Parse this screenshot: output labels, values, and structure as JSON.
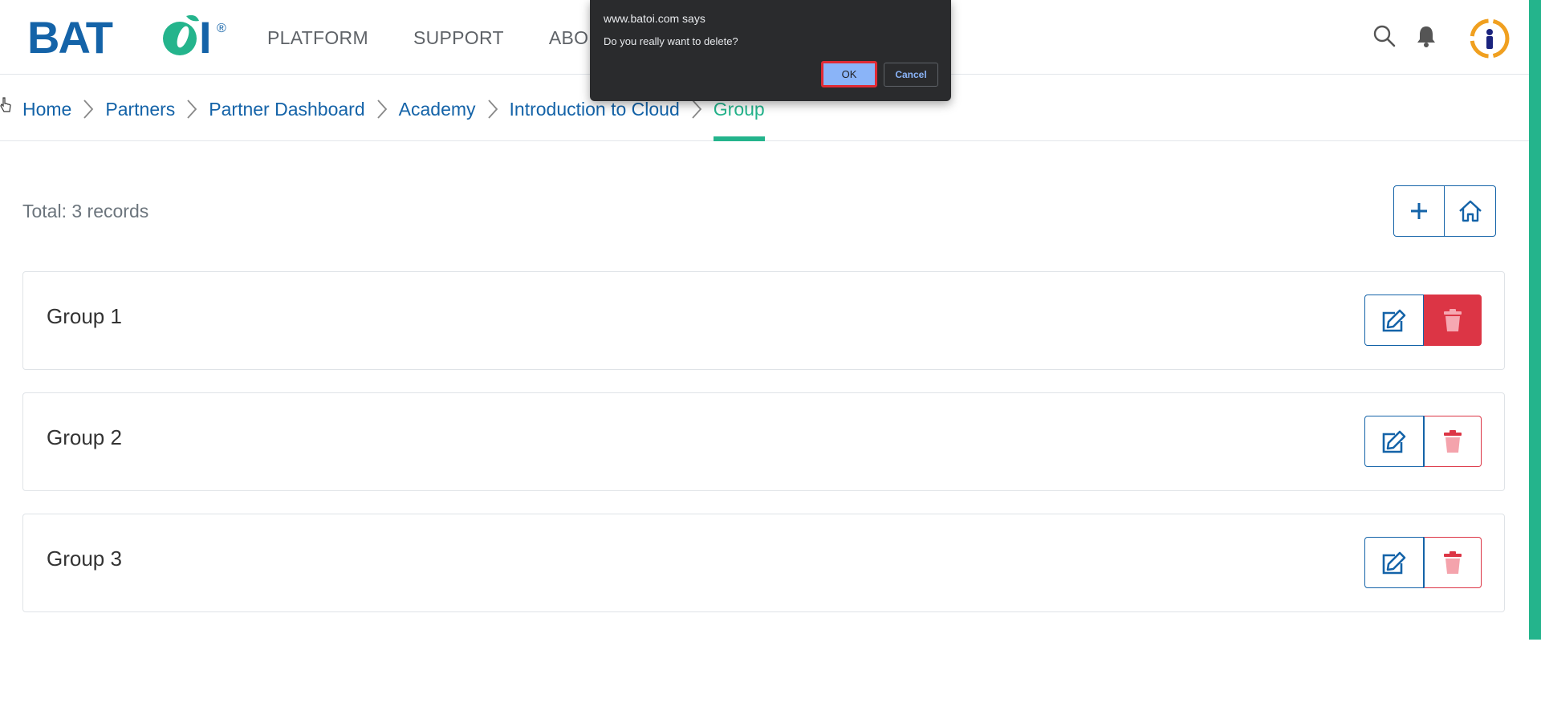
{
  "header": {
    "logo_alt": "BATOI",
    "nav": [
      {
        "label": "PLATFORM"
      },
      {
        "label": "SUPPORT"
      },
      {
        "label": "ABOU"
      }
    ]
  },
  "breadcrumb": [
    {
      "label": "Home"
    },
    {
      "label": "Partners"
    },
    {
      "label": "Partner Dashboard"
    },
    {
      "label": "Academy"
    },
    {
      "label": "Introduction to Cloud"
    },
    {
      "label": "Group",
      "active": true
    }
  ],
  "list": {
    "total_label": "Total: 3 records",
    "items": [
      {
        "title": "Group 1"
      },
      {
        "title": "Group 2"
      },
      {
        "title": "Group 3"
      }
    ]
  },
  "dialog": {
    "origin": "www.batoi.com says",
    "message": "Do you really want to delete?",
    "ok_label": "OK",
    "cancel_label": "Cancel"
  },
  "colors": {
    "brand_blue": "#1463a8",
    "accent_green": "#24b48c",
    "danger_red": "#dc3545"
  },
  "icons": {
    "search": "search-icon",
    "notifications": "bell-icon",
    "add": "plus-icon",
    "home": "home-icon",
    "edit": "edit-icon",
    "delete": "trash-icon"
  }
}
